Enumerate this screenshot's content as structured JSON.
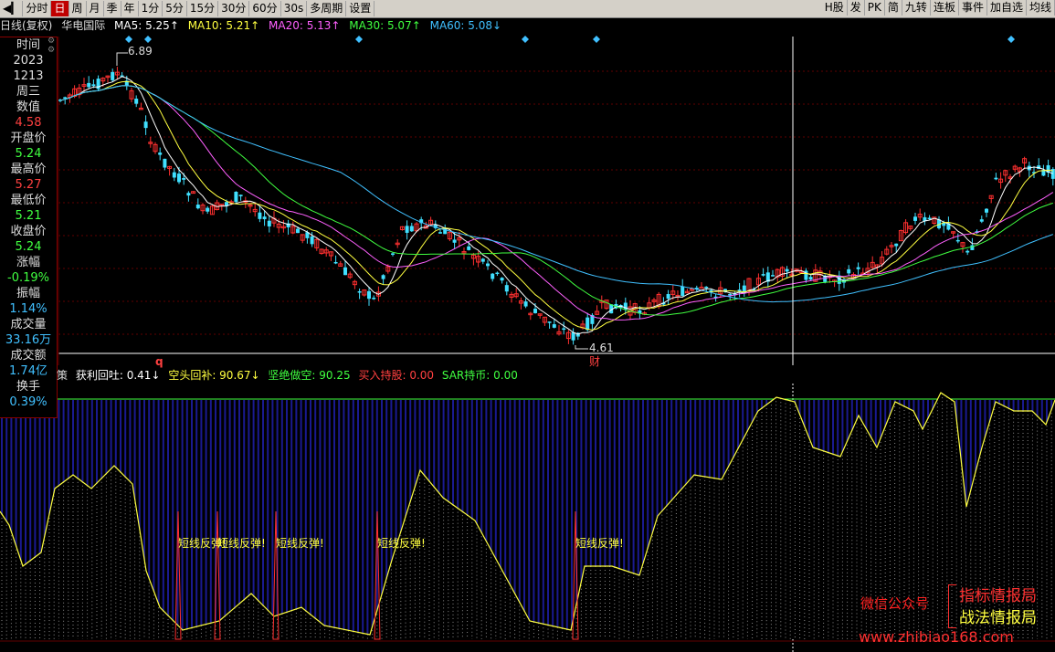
{
  "toolbar": {
    "items": [
      "分时",
      "日",
      "周",
      "月",
      "季",
      "年",
      "1分",
      "5分",
      "15分",
      "30分",
      "60分",
      "30s",
      "多周期",
      "设置"
    ],
    "active_index": 1,
    "right_items": [
      "H股",
      "发",
      "PK",
      "简",
      "九转",
      "连板",
      "事件",
      "加自选",
      "均线"
    ]
  },
  "header": {
    "period": "日线(复权)",
    "stock": "华电国际",
    "ma5": "MA5: 5.25↑",
    "ma10": "MA10: 5.21↑",
    "ma20": "MA20: 5.13↑",
    "ma30": "MA30: 5.07↑",
    "ma60": "MA60: 5.08↓"
  },
  "info": {
    "time_label": "时间",
    "year": "2023",
    "date": "1213",
    "weekday": "周三",
    "value_label": "数值",
    "value": "4.58",
    "open_label": "开盘价",
    "open": "5.24",
    "high_label": "最高价",
    "high": "5.27",
    "low_label": "最低价",
    "low": "5.21",
    "close_label": "收盘价",
    "close": "5.24",
    "change_label": "涨幅",
    "change": "-0.19%",
    "amp_label": "振幅",
    "amp": "1.14%",
    "vol_label": "成交量",
    "vol": "33.16万",
    "amount_label": "成交额",
    "amount": "1.74亿",
    "turnover_label": "换手",
    "turnover": "0.39%"
  },
  "price_labels": {
    "high": "6.89",
    "low": "4.61",
    "marker_q": "q",
    "marker_cai": "财"
  },
  "indicator": {
    "prefix": "策",
    "profit": "获利回吐: 0.41↓",
    "cover": "空头回补: 90.67↓",
    "short": "坚绝做空: 90.25",
    "buy": "买入持股: 0.00",
    "sar": "SAR持币: 0.00",
    "signal_text": "短线反弹!"
  },
  "watermark": {
    "wechat": "微信公众号",
    "brand1": "指标情报局",
    "brand2": "战法情报局",
    "url": "www.zhibiao168.com"
  },
  "colors": {
    "up": "#ff3030",
    "down": "#40e0ff",
    "ma5": "#ffffff",
    "ma10": "#ffff40",
    "ma20": "#ff60ff",
    "ma30": "#40ff40",
    "ma60": "#40c0ff",
    "ind_fill": "#1a1a90",
    "ind_line": "#ffff40"
  }
}
